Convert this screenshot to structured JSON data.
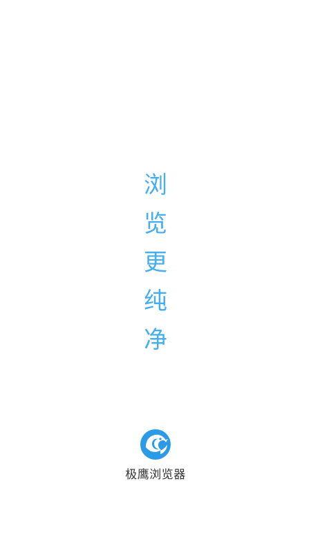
{
  "slogan": {
    "chars": [
      "浏",
      "览",
      "更",
      "纯",
      "净"
    ]
  },
  "brand": {
    "name": "极鹰浏览器",
    "logo_icon": "eagle-logo-icon",
    "logo_color": "#2b9be8"
  },
  "colors": {
    "slogan": "#45aef0",
    "background": "#ffffff",
    "brand_text": "#333333"
  }
}
